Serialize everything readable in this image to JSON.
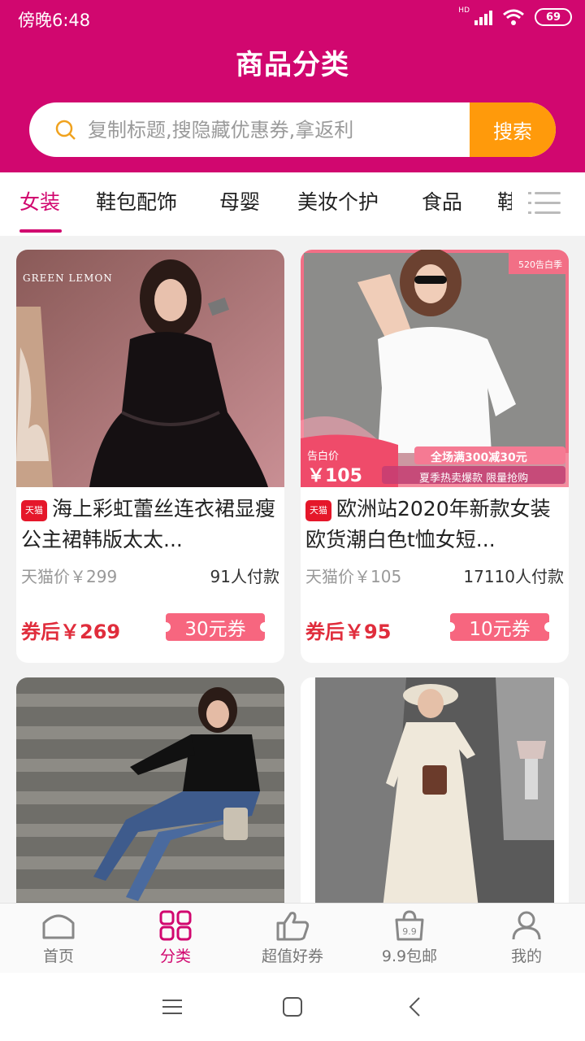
{
  "status_bar": {
    "time": "傍晚6:48",
    "battery": "69",
    "network": "HD"
  },
  "header": {
    "title": "商品分类"
  },
  "search": {
    "placeholder": "复制标题,搜隐藏优惠券,拿返利",
    "button": "搜索"
  },
  "tabs": [
    {
      "label": "女装",
      "active": true
    },
    {
      "label": "鞋包配饰"
    },
    {
      "label": "母婴"
    },
    {
      "label": "美妆个护"
    },
    {
      "label": "食品"
    },
    {
      "label": "鞋"
    }
  ],
  "products": [
    {
      "store_badge": "天猫",
      "title": "海上彩虹蕾丝连衣裙显瘦公主裙韩版太太...",
      "tmall_price": "天猫价￥299",
      "sales": "91人付款",
      "after_coupon_price": "券后￥269",
      "coupon": "30元券",
      "image_text": {
        "brand": "GREEN LEMON"
      }
    },
    {
      "store_badge": "天猫",
      "title": "欧洲站2020年新款女装欧货潮白色t恤女短...",
      "tmall_price": "天猫价￥105",
      "sales": "17110人付款",
      "after_coupon_price": "券后￥95",
      "coupon": "10元券",
      "image_text": {
        "corner_tag": "520告白季",
        "price_label": "告白价",
        "price": "￥105",
        "promo": "全场满300减30元",
        "promo_sub": "夏季热卖爆款 限量抢购"
      }
    },
    {
      "store_badge": "",
      "title": "",
      "tmall_price": "",
      "sales": "",
      "after_coupon_price": "",
      "coupon": ""
    },
    {
      "store_badge": "",
      "title": "",
      "tmall_price": "",
      "sales": "",
      "after_coupon_price": "",
      "coupon": ""
    }
  ],
  "tabbar": [
    {
      "label": "首页",
      "icon": "home-icon"
    },
    {
      "label": "分类",
      "icon": "category-grid-icon",
      "active": true
    },
    {
      "label": "超值好券",
      "icon": "thumbs-up-icon"
    },
    {
      "label": "9.9包邮",
      "icon": "shopping-bag-icon",
      "icon_text": "9.9"
    },
    {
      "label": "我的",
      "icon": "user-icon"
    }
  ],
  "colors": {
    "brand": "#d1076f",
    "search_button": "#ff9a0b",
    "price_red": "#e02d3c",
    "coupon": "#f7667f"
  }
}
